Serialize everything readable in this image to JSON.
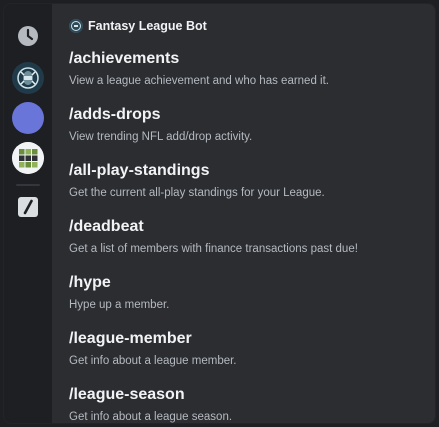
{
  "header": {
    "title": "Fantasy League Bot",
    "avatar_icon": "bot-avatar-icon"
  },
  "rail": {
    "items": [
      {
        "icon": "clock-icon"
      },
      {
        "icon": "bot-avatar-icon"
      },
      {
        "icon": "blue-circle-app-icon",
        "color": "#6975d8"
      },
      {
        "icon": "grid-app-icon"
      },
      {
        "icon": "slash-commands-icon"
      }
    ]
  },
  "commands": [
    {
      "name": "/achievements",
      "description": "View a league achievement and who has earned it."
    },
    {
      "name": "/adds-drops",
      "description": "View trending NFL add/drop activity."
    },
    {
      "name": "/all-play-standings",
      "description": "Get the current all-play standings for your League."
    },
    {
      "name": "/deadbeat",
      "description": "Get a list of members with finance transactions past due!"
    },
    {
      "name": "/hype",
      "description": "Hype up a member."
    },
    {
      "name": "/league-member",
      "description": "Get info about a league member."
    },
    {
      "name": "/league-season",
      "description": "Get info about a league season."
    }
  ],
  "colors": {
    "background": "#2b2d31",
    "rail": "#1e1f22",
    "text_primary": "#f2f3f5",
    "text_secondary": "#b5bac1",
    "accent_blue": "#6975d8"
  }
}
